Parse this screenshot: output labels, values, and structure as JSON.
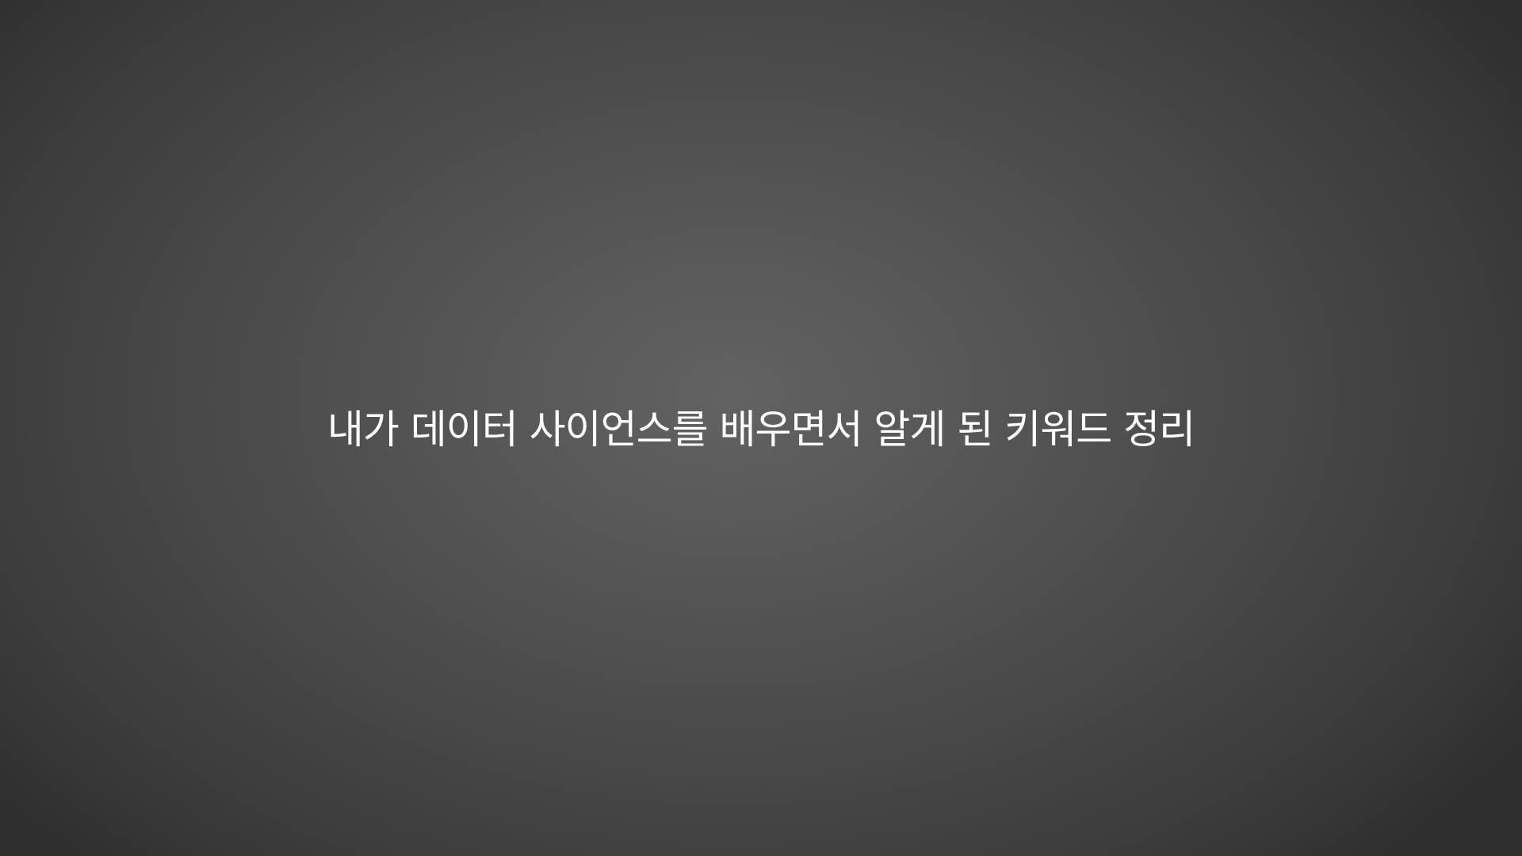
{
  "slide": {
    "title": "내가 데이터 사이언스를 배우면서 알게 된 키워드 정리",
    "background": {
      "center_color": "#626262",
      "edge_color": "#2f2f2f"
    },
    "text_color": "#ffffff"
  }
}
